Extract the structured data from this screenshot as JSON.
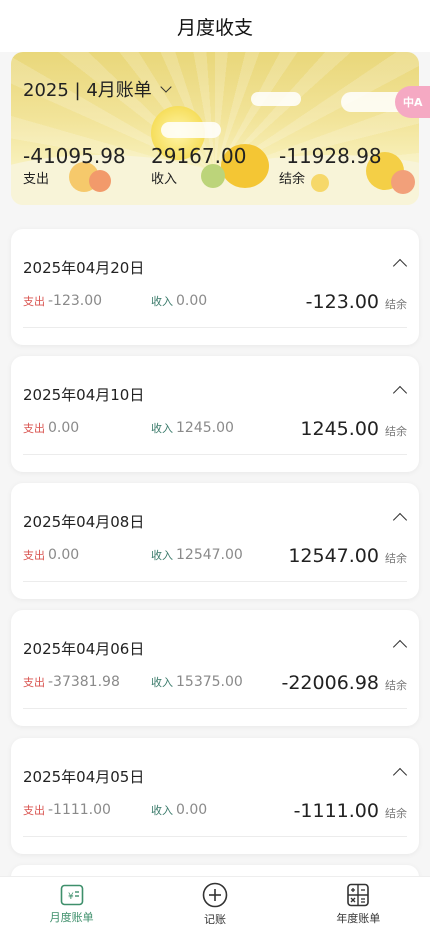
{
  "header": {
    "title": "月度收支"
  },
  "summary": {
    "month_selector": "2025 | 4月账单",
    "expense_value": "-41095.98",
    "expense_label": "支出",
    "income_value": "29167.00",
    "income_label": "收入",
    "balance_value": "-11928.98",
    "balance_label": "结余"
  },
  "records": [
    {
      "date": "2025年04月20日",
      "expense_tag": "支出",
      "expense": "-123.00",
      "income_tag": "收入",
      "income": "0.00",
      "balance": "-123.00",
      "balance_tag": "结余"
    },
    {
      "date": "2025年04月10日",
      "expense_tag": "支出",
      "expense": "0.00",
      "income_tag": "收入",
      "income": "1245.00",
      "balance": "1245.00",
      "balance_tag": "结余"
    },
    {
      "date": "2025年04月08日",
      "expense_tag": "支出",
      "expense": "0.00",
      "income_tag": "收入",
      "income": "12547.00",
      "balance": "12547.00",
      "balance_tag": "结余"
    },
    {
      "date": "2025年04月06日",
      "expense_tag": "支出",
      "expense": "-37381.98",
      "income_tag": "收入",
      "income": "15375.00",
      "balance": "-22006.98",
      "balance_tag": "结余"
    },
    {
      "date": "2025年04月05日",
      "expense_tag": "支出",
      "expense": "-1111.00",
      "income_tag": "收入",
      "income": "0.00",
      "balance": "-1111.00",
      "balance_tag": "结余"
    }
  ],
  "tabs": [
    {
      "label": "月度账单",
      "icon": "bill-icon",
      "active": true
    },
    {
      "label": "记账",
      "icon": "add-circle-icon",
      "active": false
    },
    {
      "label": "年度账单",
      "icon": "calculator-icon",
      "active": false
    }
  ],
  "colors": {
    "accent": "#3e8f6b",
    "expense_tag": "#d9534f",
    "income_tag": "#3a7a6a",
    "translate_badge": "#f5a9c3"
  }
}
